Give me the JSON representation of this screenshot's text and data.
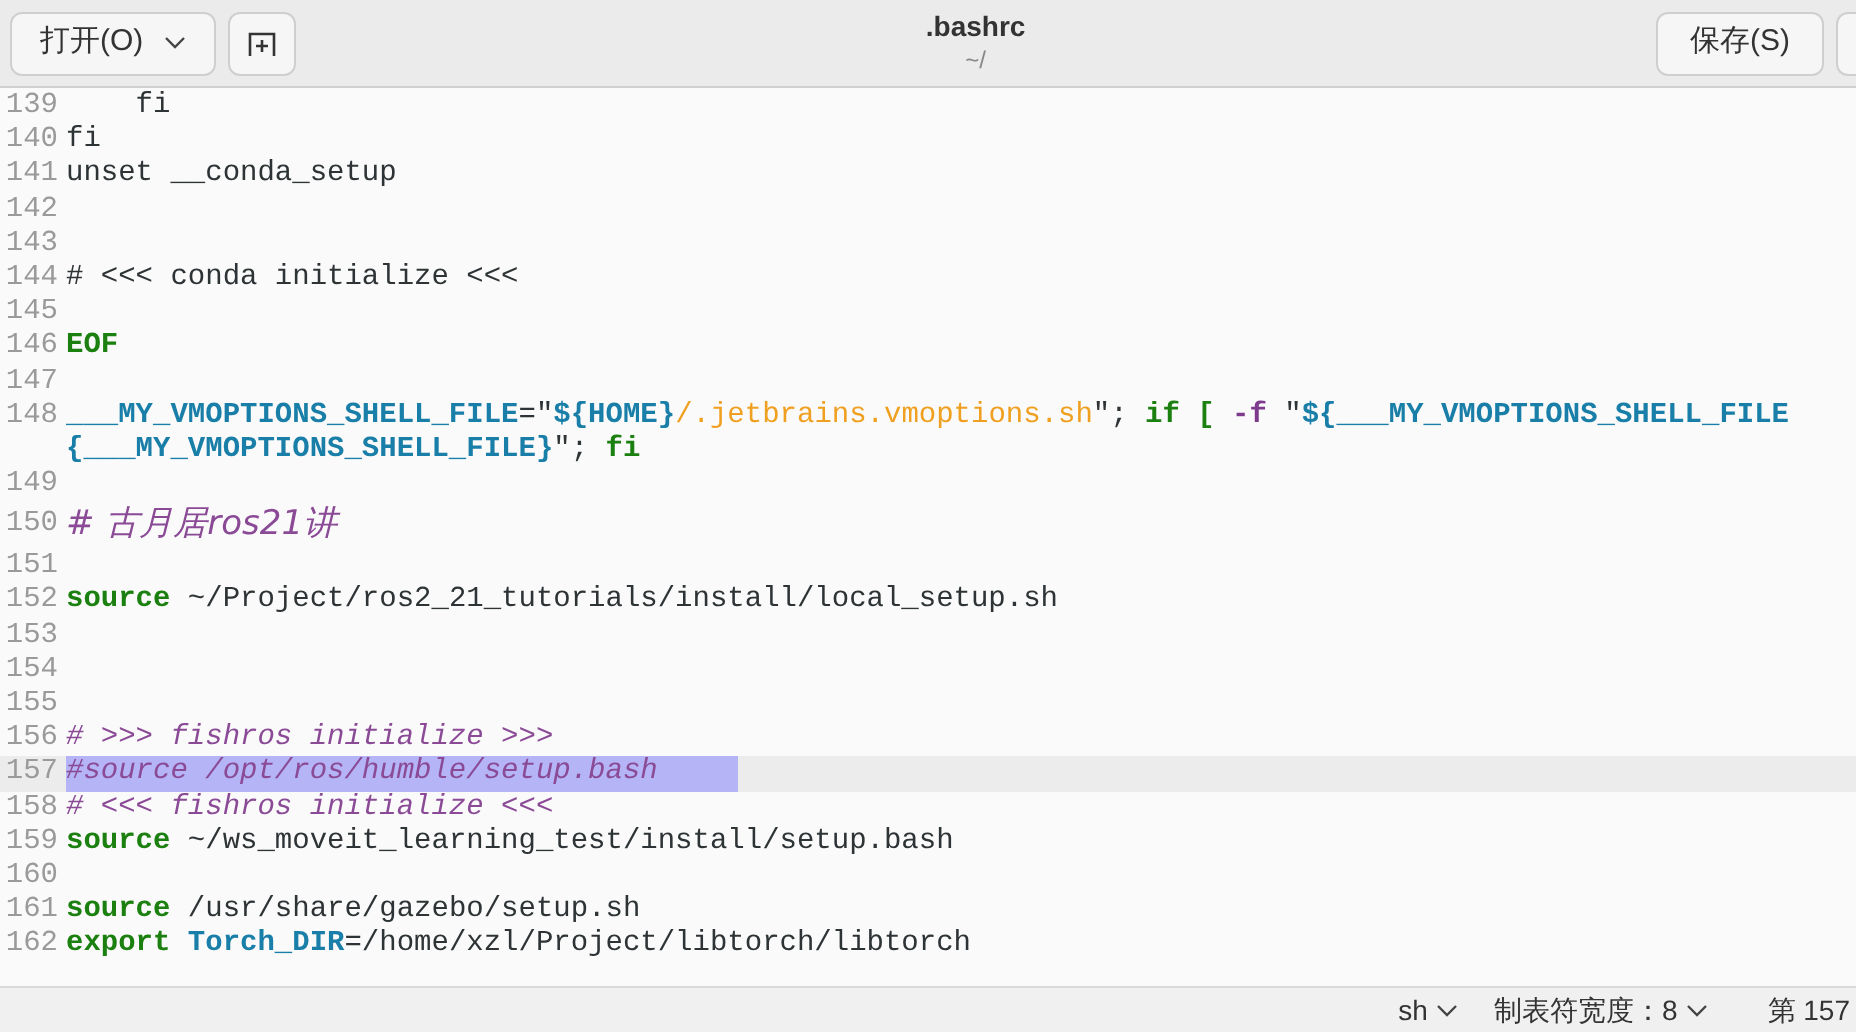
{
  "header": {
    "open_button": "打开(O)",
    "title": ".bashrc",
    "subtitle": "~/",
    "save_button": "保存(S)"
  },
  "editor": {
    "lines": [
      {
        "number": "139",
        "selected": false,
        "tokens": [
          {
            "kind": "plain",
            "text": "    fi"
          }
        ]
      },
      {
        "number": "140",
        "selected": false,
        "tokens": [
          {
            "kind": "plain",
            "text": "fi"
          }
        ]
      },
      {
        "number": "141",
        "selected": false,
        "tokens": [
          {
            "kind": "plain",
            "text": "unset __conda_setup"
          }
        ]
      },
      {
        "number": "142",
        "selected": false
      },
      {
        "number": "143",
        "selected": false
      },
      {
        "number": "144",
        "selected": false,
        "tokens": [
          {
            "kind": "plain",
            "text": "# <<< conda initialize <<<"
          }
        ]
      },
      {
        "number": "145",
        "selected": false
      },
      {
        "number": "146",
        "selected": false,
        "tokens": [
          {
            "kind": "keyword",
            "text": "EOF"
          }
        ]
      },
      {
        "number": "147",
        "selected": false
      },
      {
        "number": "148",
        "selected": false,
        "tokens": [
          {
            "kind": "variable",
            "text": "___MY_VMOPTIONS_SHELL_FILE"
          },
          {
            "kind": "plain",
            "text": "=\""
          },
          {
            "kind": "variable",
            "text": "${HOME}"
          },
          {
            "kind": "string",
            "text": "/.jetbrains.vmoptions.sh"
          },
          {
            "kind": "plain",
            "text": "\"; "
          },
          {
            "kind": "keyword",
            "text": "if"
          },
          {
            "kind": "keyword",
            "text": " ["
          },
          {
            "kind": "option",
            "text": " -f"
          },
          {
            "kind": "plain",
            "text": " \""
          },
          {
            "kind": "variable",
            "text": "${___MY_VMOPTIONS_SHELL_FILE"
          }
        ],
        "continuation": [
          {
            "kind": "variable",
            "text": "{___MY_VMOPTIONS_SHELL_FILE}"
          },
          {
            "kind": "plain",
            "text": "\"; "
          },
          {
            "kind": "keyword",
            "text": "fi"
          }
        ]
      },
      {
        "number": "149",
        "selected": false
      },
      {
        "number": "150",
        "selected": false,
        "tokens": [
          {
            "kind": "comment",
            "text": "# 古月居ros21讲"
          }
        ]
      },
      {
        "number": "151",
        "selected": false
      },
      {
        "number": "152",
        "selected": false,
        "tokens": [
          {
            "kind": "keyword",
            "text": "source"
          },
          {
            "kind": "plain",
            "text": " ~/Project/ros2_21_tutorials/install/local_setup.sh"
          }
        ]
      },
      {
        "number": "153",
        "selected": false
      },
      {
        "number": "154",
        "selected": false
      },
      {
        "number": "155",
        "selected": false
      },
      {
        "number": "156",
        "selected": false,
        "tokens": [
          {
            "kind": "comment",
            "text": "# >>> fishros initialize >>>"
          }
        ]
      },
      {
        "number": "157",
        "selected": true,
        "tokens": [
          {
            "kind": "comment",
            "text": "#source /opt/ros/humble/setup.bash"
          }
        ]
      },
      {
        "number": "158",
        "selected": false,
        "tokens": [
          {
            "kind": "comment",
            "text": "# <<< fishros initialize <<<"
          }
        ]
      },
      {
        "number": "159",
        "selected": false,
        "tokens": [
          {
            "kind": "keyword",
            "text": "source"
          },
          {
            "kind": "plain",
            "text": " ~/ws_moveit_learning_test/install/setup.bash"
          }
        ]
      },
      {
        "number": "160",
        "selected": false
      },
      {
        "number": "161",
        "selected": false,
        "tokens": [
          {
            "kind": "keyword",
            "text": "source"
          },
          {
            "kind": "plain",
            "text": " /usr/share/gazebo/setup.sh"
          }
        ]
      },
      {
        "number": "162",
        "selected": false,
        "tokens": [
          {
            "kind": "keyword",
            "text": "export"
          },
          {
            "kind": "variable",
            "text": " Torch_DIR"
          },
          {
            "kind": "plain",
            "text": "=/home/xzl/Project/libtorch/libtorch"
          }
        ]
      }
    ]
  },
  "status_bar": {
    "language": "sh",
    "tab_width": "制表符宽度：8",
    "position": "第 157"
  }
}
